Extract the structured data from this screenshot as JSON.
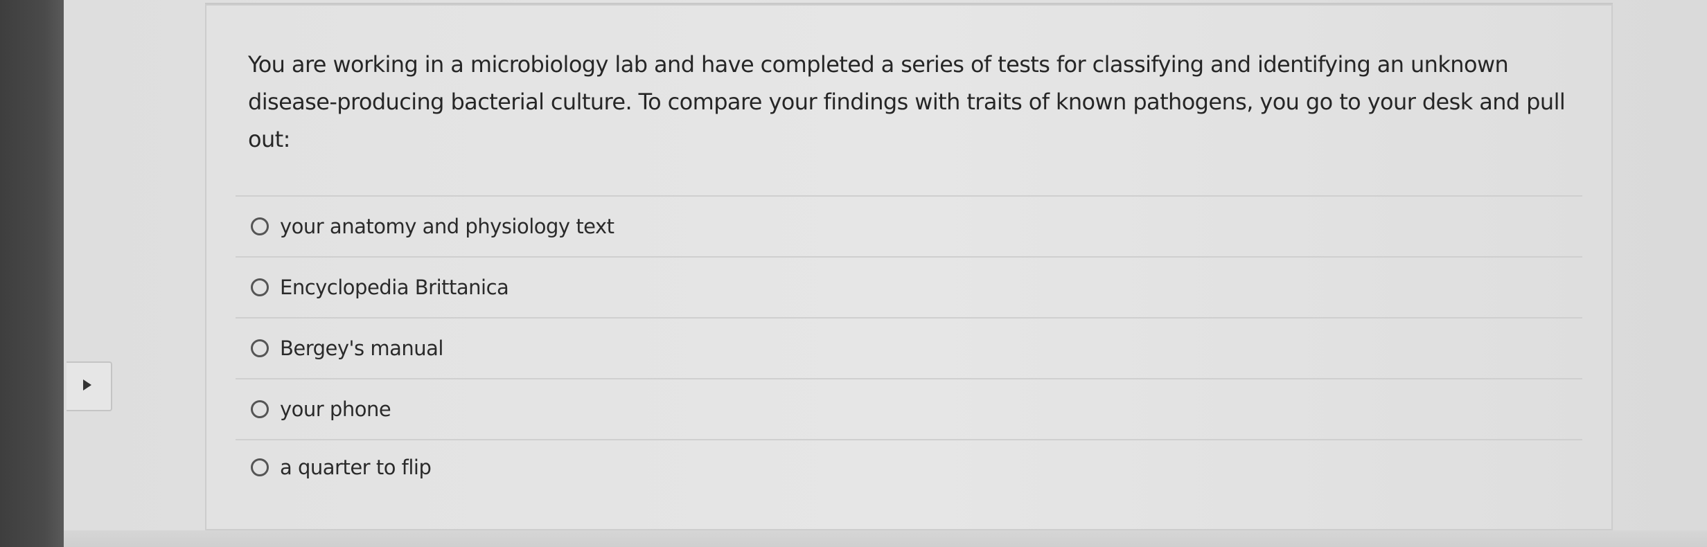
{
  "question": {
    "text": "You are working in a microbiology lab and have completed a series of tests for classifying and identifying an unknown disease-producing bacterial culture. To compare your findings with traits of known pathogens, you go to your desk and pull out:"
  },
  "options": [
    {
      "label": "your anatomy and physiology text"
    },
    {
      "label": "Encyclopedia Brittanica"
    },
    {
      "label": "Bergey's manual"
    },
    {
      "label": "your phone"
    },
    {
      "label": "a quarter to flip"
    }
  ],
  "icons": {
    "side_tab": "play-arrow-icon",
    "radio": "radio-unselected-icon"
  }
}
